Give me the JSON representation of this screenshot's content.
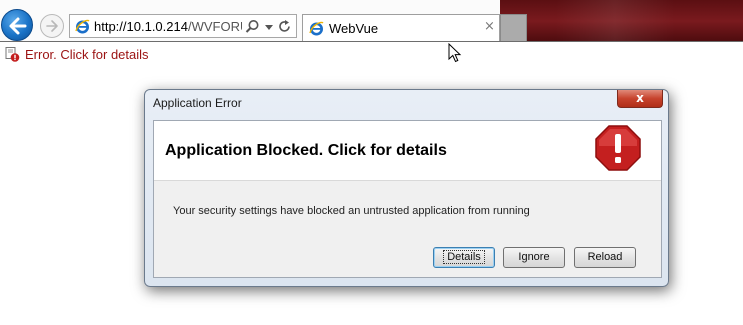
{
  "browser": {
    "address_url_bold": "http://10.1.0.214",
    "address_url_rest": "/WVFORUM",
    "tab_title": "WebVue",
    "tab_close": "×"
  },
  "page": {
    "error_text": "Error. Click for details"
  },
  "dialog": {
    "title": "Application Error",
    "close_glyph": "x",
    "heading": "Application Blocked. Click for details",
    "message": "Your security settings have blocked an untrusted application from running",
    "buttons": {
      "details": "Details",
      "ignore": "Ignore",
      "reload": "Reload"
    }
  },
  "icons": {
    "back": "back-arrow-icon",
    "forward": "forward-arrow-icon",
    "browser": "internet-explorer-icon",
    "search": "search-icon",
    "dropdown": "chevron-down-icon",
    "refresh": "refresh-icon",
    "page_error": "error-page-icon",
    "stop": "stop-sign-icon",
    "cursor": "mouse-cursor-icon"
  },
  "colors": {
    "error_text": "#9b1212",
    "back_button": "#1a73c7",
    "stop_sign": "#c41f1f",
    "dialog_close": "#c7432d"
  }
}
